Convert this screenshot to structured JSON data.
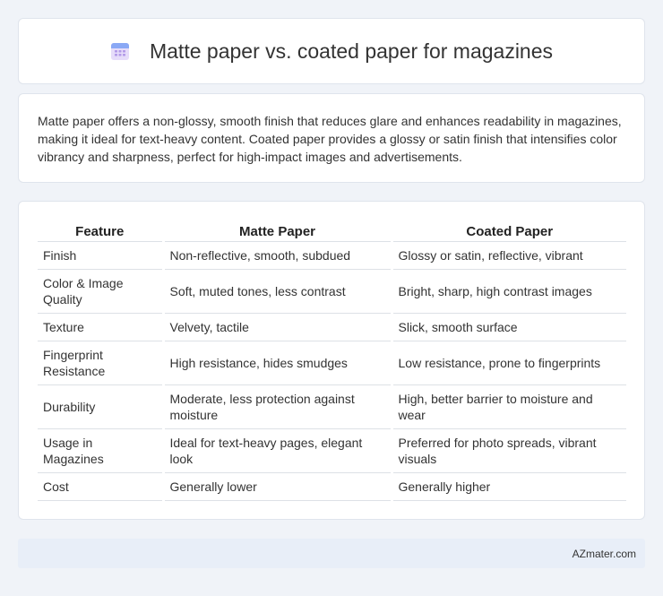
{
  "header": {
    "title": "Matte paper vs. coated paper for magazines",
    "icon": "calendar-icon",
    "colors": {
      "icon_top": "#8aa8f5",
      "icon_body": "#e6dcfa",
      "icon_dots": "#b39ae8"
    }
  },
  "intro": {
    "text": "Matte paper offers a non-glossy, smooth finish that reduces glare and enhances readability in magazines, making it ideal for text-heavy content. Coated paper provides a glossy or satin finish that intensifies color vibrancy and sharpness, perfect for high-impact images and advertisements."
  },
  "table": {
    "headers": [
      "Feature",
      "Matte Paper",
      "Coated Paper"
    ],
    "rows": [
      [
        "Finish",
        "Non-reflective, smooth, subdued",
        "Glossy or satin, reflective, vibrant"
      ],
      [
        "Color & Image Quality",
        "Soft, muted tones, less contrast",
        "Bright, sharp, high contrast images"
      ],
      [
        "Texture",
        "Velvety, tactile",
        "Slick, smooth surface"
      ],
      [
        "Fingerprint Resistance",
        "High resistance, hides smudges",
        "Low resistance, prone to fingerprints"
      ],
      [
        "Durability",
        "Moderate, less protection against moisture",
        "High, better barrier to moisture and wear"
      ],
      [
        "Usage in Magazines",
        "Ideal for text-heavy pages, elegant look",
        "Preferred for photo spreads, vibrant visuals"
      ],
      [
        "Cost",
        "Generally lower",
        "Generally higher"
      ]
    ]
  },
  "footer": {
    "brand": "AZmater.com"
  }
}
